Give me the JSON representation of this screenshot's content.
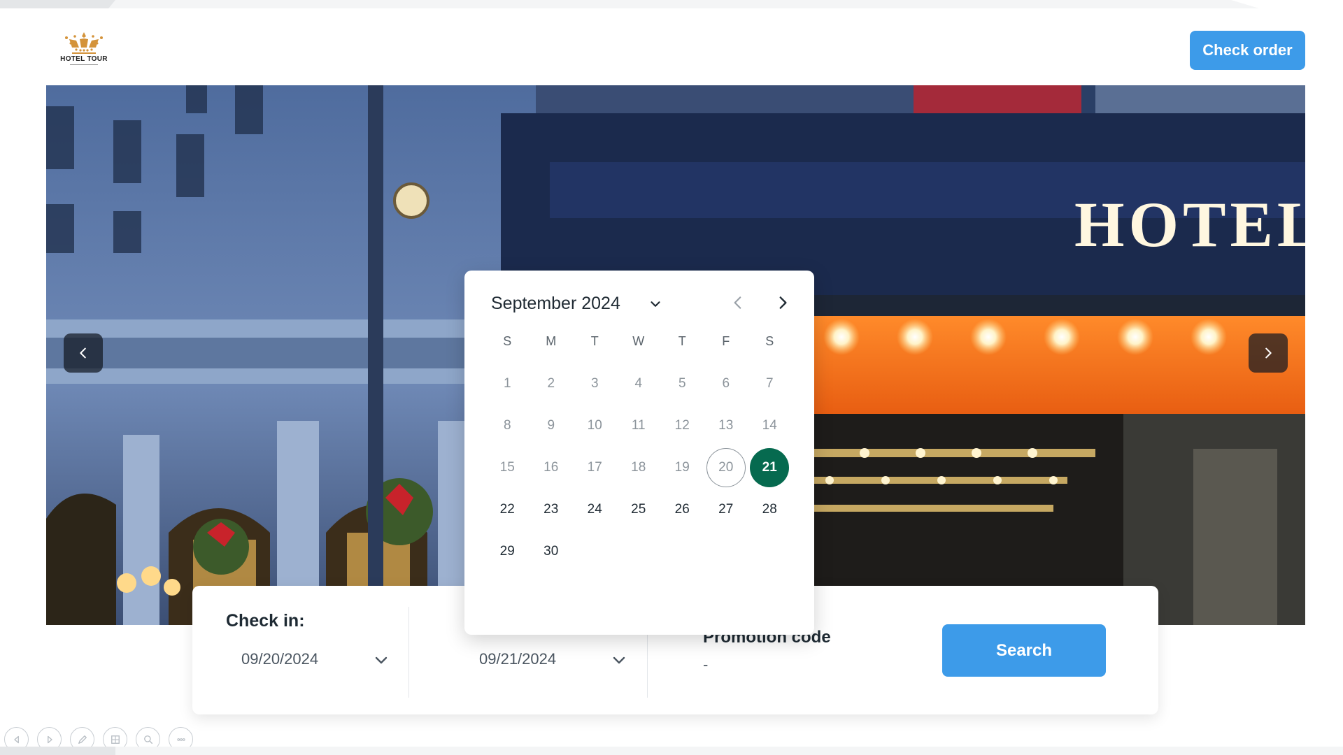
{
  "header": {
    "logo_text": "HOTEL TOUR",
    "logo_sub": "HOTEL TOUR",
    "check_order_label": "Check order"
  },
  "hero": {
    "sign_text": "HOTEL",
    "prev_icon": "chevron-left-icon",
    "next_icon": "chevron-right-icon"
  },
  "search": {
    "checkin_label": "Check in:",
    "checkin_value": "09/20/2024",
    "checkout_value": "09/21/2024",
    "promo_label": "Promotion code",
    "promo_value": "-",
    "search_label": "Search"
  },
  "calendar": {
    "month_label": "September 2024",
    "weekdays": [
      "S",
      "M",
      "T",
      "W",
      "T",
      "F",
      "S"
    ],
    "days": [
      {
        "d": "1",
        "state": "past"
      },
      {
        "d": "2",
        "state": "past"
      },
      {
        "d": "3",
        "state": "past"
      },
      {
        "d": "4",
        "state": "past"
      },
      {
        "d": "5",
        "state": "past"
      },
      {
        "d": "6",
        "state": "past"
      },
      {
        "d": "7",
        "state": "past"
      },
      {
        "d": "8",
        "state": "past"
      },
      {
        "d": "9",
        "state": "past"
      },
      {
        "d": "10",
        "state": "past"
      },
      {
        "d": "11",
        "state": "past"
      },
      {
        "d": "12",
        "state": "past"
      },
      {
        "d": "13",
        "state": "past"
      },
      {
        "d": "14",
        "state": "past"
      },
      {
        "d": "15",
        "state": "past"
      },
      {
        "d": "16",
        "state": "past"
      },
      {
        "d": "17",
        "state": "past"
      },
      {
        "d": "18",
        "state": "past"
      },
      {
        "d": "19",
        "state": "past"
      },
      {
        "d": "20",
        "state": "start"
      },
      {
        "d": "21",
        "state": "end"
      },
      {
        "d": "22",
        "state": "avail"
      },
      {
        "d": "23",
        "state": "avail"
      },
      {
        "d": "24",
        "state": "avail"
      },
      {
        "d": "25",
        "state": "avail"
      },
      {
        "d": "26",
        "state": "avail"
      },
      {
        "d": "27",
        "state": "avail"
      },
      {
        "d": "28",
        "state": "avail"
      },
      {
        "d": "29",
        "state": "avail"
      },
      {
        "d": "30",
        "state": "avail"
      }
    ],
    "selected_color": "#066a4f"
  },
  "colors": {
    "primary": "#3d9be9"
  },
  "toolbar": {
    "icons": [
      "arrow-left-icon",
      "arrow-right-icon",
      "pen-icon",
      "slides-icon",
      "zoom-icon",
      "more-icon"
    ]
  }
}
